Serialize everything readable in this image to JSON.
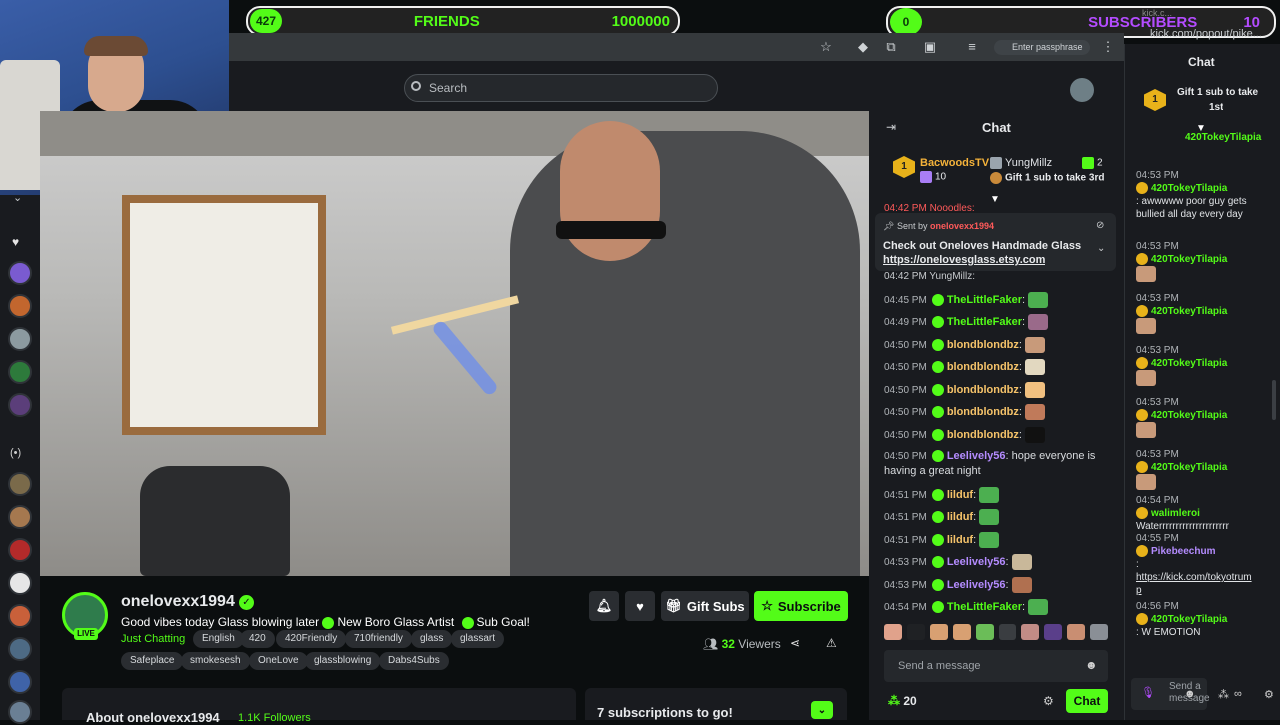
{
  "overlay": {
    "friends_left": "427",
    "friends_label": "FRIENDS",
    "friends_value": "1000000",
    "subs_left": "0",
    "subs_label": "SUBSCRIBERS",
    "subs_value": "10",
    "colors": {
      "accent": "#53fc18",
      "subs": "#b44cff"
    }
  },
  "browser": {
    "url": "kick.com/popout/pike...",
    "passphrase": "Enter passphrase",
    "tab": "kick.c..."
  },
  "search": {
    "placeholder": "Search"
  },
  "stream": {
    "channel": "onelovexx1994",
    "live": "LIVE",
    "title_1": "Good vibes today Glass blowing later",
    "title_2": "New Boro Glass Artist",
    "title_3": "Sub Goal!",
    "category": "Just Chatting",
    "tags": [
      "English",
      "420",
      "420Friendly",
      "710friendly",
      "glass",
      "glassart"
    ],
    "tags2": [
      "Safeplace",
      "smokesesh",
      "OneLove",
      "glassblowing",
      "Dabs4Subs"
    ],
    "gift_subs": "Gift Subs",
    "subscribe": "Subscribe",
    "viewers": "32",
    "viewers_label": "Viewers",
    "about": "About onelovexx1994",
    "followers": "1.1K Followers",
    "sub_goal": "7 subscriptions to go!"
  },
  "chat": {
    "header": "Chat",
    "top": {
      "name1": "BacwoodsTV",
      "count1": "10",
      "name2": "YungMillz",
      "count2": "2",
      "gift": "Gift 1 sub to take 3rd"
    },
    "pin": {
      "sent_by": "Sent by",
      "sender": "onelovexx1994",
      "message": "Check out Oneloves Handmade Glass",
      "link": "https://onelovesglass.etsy.com"
    },
    "partial_top": "04:42 PM Nooodles:",
    "partial_2": "04:42 PM YungMillz:",
    "messages": [
      {
        "t": "04:45 PM",
        "u": "TheLittleFaker",
        "m": ""
      },
      {
        "t": "04:49 PM",
        "u": "TheLittleFaker",
        "m": ""
      },
      {
        "t": "04:50 PM",
        "u": "blondblondbz",
        "m": ""
      },
      {
        "t": "04:50 PM",
        "u": "blondblondbz",
        "m": ""
      },
      {
        "t": "04:50 PM",
        "u": "blondblondbz",
        "m": ""
      },
      {
        "t": "04:50 PM",
        "u": "blondblondbz",
        "m": ""
      },
      {
        "t": "04:50 PM",
        "u": "blondblondbz",
        "m": ""
      },
      {
        "t": "04:50 PM",
        "u": "Leelively56",
        "m": "hope everyone is",
        "m2": "having a great night"
      },
      {
        "t": "04:51 PM",
        "u": "lilduf",
        "m": ""
      },
      {
        "t": "04:51 PM",
        "u": "lilduf",
        "m": ""
      },
      {
        "t": "04:51 PM",
        "u": "lilduf",
        "m": ""
      },
      {
        "t": "04:53 PM",
        "u": "Leelively56",
        "m": ""
      },
      {
        "t": "04:53 PM",
        "u": "Leelively56",
        "m": ""
      },
      {
        "t": "04:54 PM",
        "u": "TheLittleFaker",
        "m": ""
      }
    ],
    "input_placeholder": "Send a message",
    "kicks": "20",
    "chat_button": "Chat"
  },
  "popout": {
    "header": "Chat",
    "gift": "Gift 1 sub to take",
    "gift2": "1st",
    "msgs": [
      {
        "t": "04:53 PM",
        "u": "420TokeyTilapia",
        "m": ": awwwww poor guy gets",
        "m2": "bullied all day every day"
      },
      {
        "t": "04:53 PM",
        "u": "420TokeyTilapia",
        "m": ""
      },
      {
        "t": "04:53 PM",
        "u": "420TokeyTilapia",
        "m": ""
      },
      {
        "t": "04:53 PM",
        "u": "420TokeyTilapia",
        "m": ""
      },
      {
        "t": "04:53 PM",
        "u": "420TokeyTilapia",
        "m": ""
      },
      {
        "t": "04:53 PM",
        "u": "420TokeyTilapia",
        "m": ""
      },
      {
        "t": "04:54 PM",
        "u": "walimleroi",
        "m": "Waterrrrrrrrrrrrrrrrrrrrr"
      },
      {
        "t": "04:55 PM",
        "u": "Pikebeechum",
        "m": ":",
        "m2": "https://kick.com/tokyotrum",
        "m3": "p"
      },
      {
        "t": "04:56 PM",
        "u": "420TokeyTilapia",
        "m": ": W EMOTION"
      }
    ],
    "top_partial": "420TokeyTilapia",
    "send": "Send a",
    "send2": "message"
  }
}
